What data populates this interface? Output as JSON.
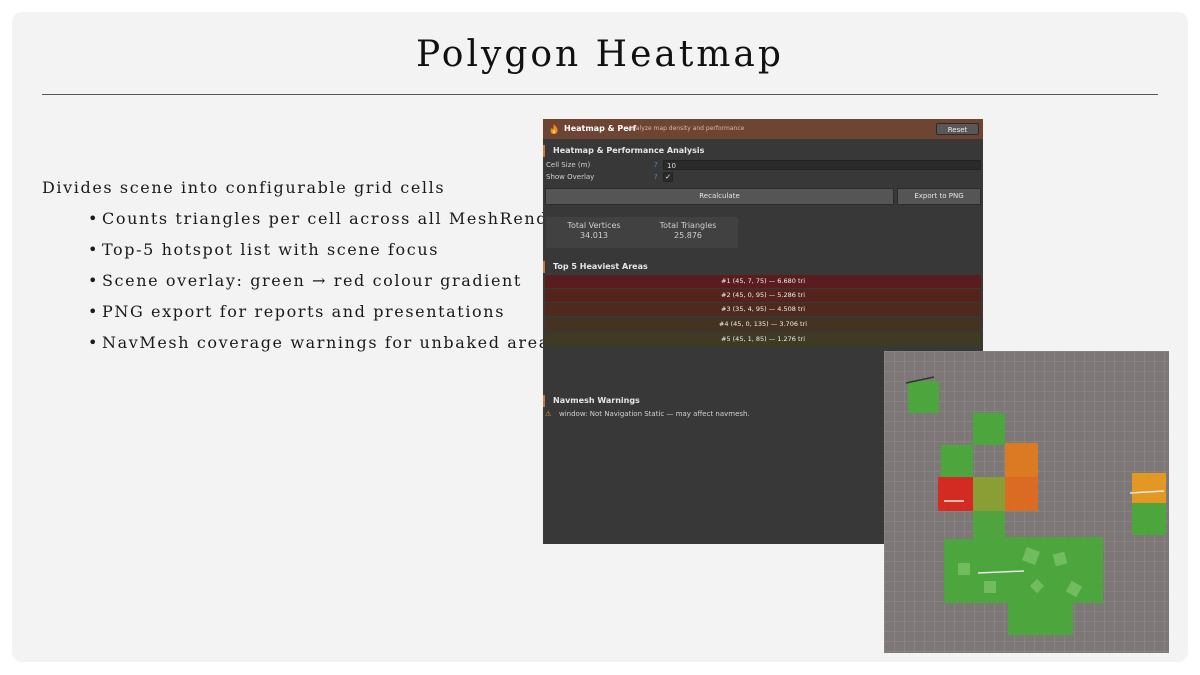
{
  "slide": {
    "title": "Polygon Heatmap",
    "lead": "Divides scene into configurable grid cells",
    "bullets": [
      "Counts triangles per cell across all MeshRenderers",
      "Top-5 hotspot list with scene focus",
      "Scene overlay: green → red colour gradient",
      "PNG export for reports and presentations",
      "NavMesh coverage warnings for unbaked areas"
    ]
  },
  "panel": {
    "icon": "fire-icon",
    "title": "Heatmap & Perf",
    "subtitle": "Analyze map density and performance",
    "reset_label": "Reset",
    "section_title": "Heatmap & Performance Analysis",
    "cell_size_label": "Cell Size (m)",
    "cell_size_value": "10",
    "show_overlay_label": "Show Overlay",
    "show_overlay_checked": true,
    "help_glyph": "?",
    "check_glyph": "✓",
    "recalculate_label": "Recalculate",
    "export_label": "Export to PNG",
    "stats": {
      "vertices_label": "Total Vertices",
      "vertices_value": "34.013",
      "triangles_label": "Total Triangles",
      "triangles_value": "25.876"
    },
    "hotspots_title": "Top 5 Heaviest Areas",
    "hotspots": [
      {
        "text": "#1  (45, 7, 75)  —  6.680 tri",
        "color": "#5a1c1c"
      },
      {
        "text": "#2  (45, 0, 95)  —  5.286 tri",
        "color": "#53231c"
      },
      {
        "text": "#3  (35, 4, 95)  —  4.508 tri",
        "color": "#4d2a1c"
      },
      {
        "text": "#4  (45, 0, 135)  —  3.706 tri",
        "color": "#463220"
      },
      {
        "text": "#5  (45, 1, 85)  —  1.276 tri",
        "color": "#3f3a22"
      }
    ],
    "navmesh_title": "Navmesh Warnings",
    "navmesh_warnings": [
      "window: Not Navigation Static — may affect navmesh."
    ],
    "warning_icon": "warning-icon"
  },
  "scene": {
    "description_colors": {
      "green": "#4aa83a",
      "orange": "#e07a1e",
      "red": "#d8261e",
      "olive": "#8aa030"
    }
  }
}
